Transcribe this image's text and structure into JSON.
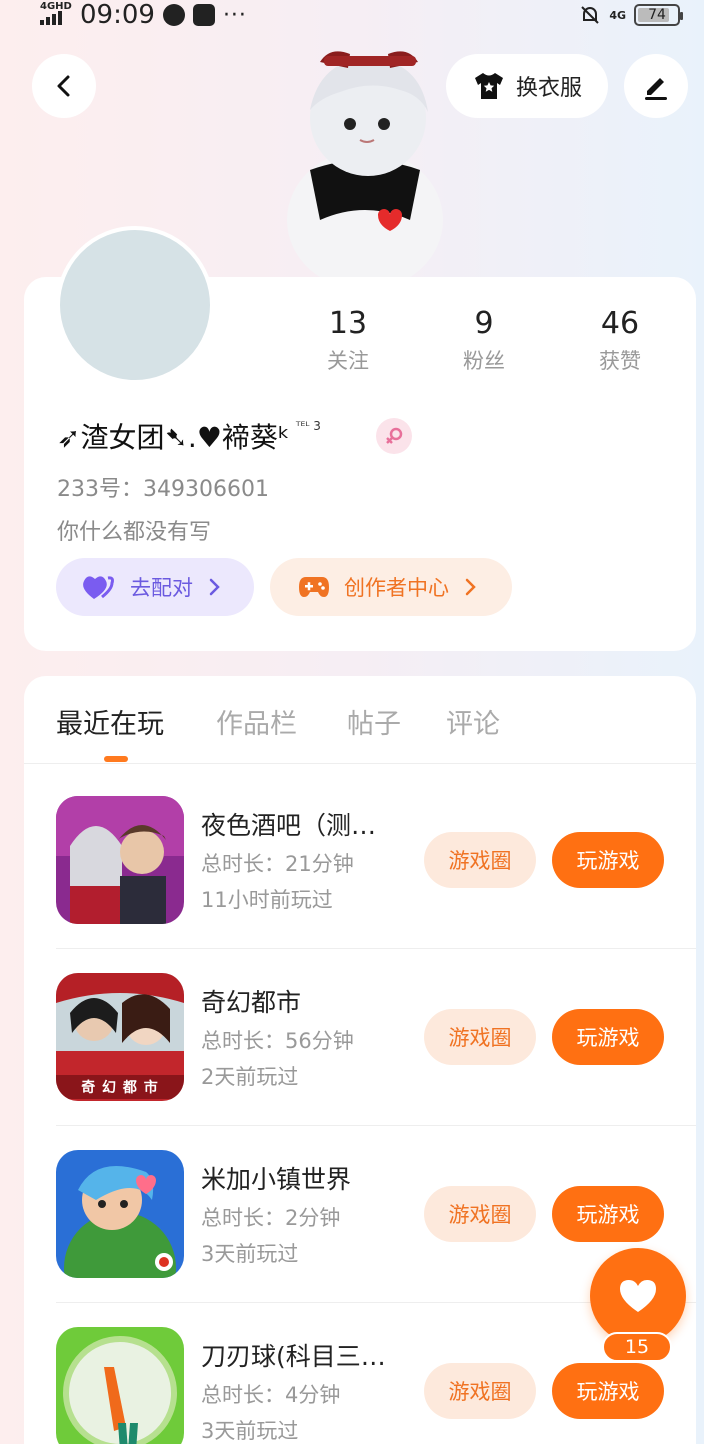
{
  "status_bar": {
    "network": "4GHD",
    "time": "09:09",
    "battery": "74",
    "signal_right": "4G"
  },
  "header": {
    "outfit_label": "换衣服"
  },
  "profile": {
    "stats": [
      {
        "value": "13",
        "label": "关注"
      },
      {
        "value": "9",
        "label": "粉丝"
      },
      {
        "value": "46",
        "label": "获赞"
      }
    ],
    "nickname": "➶渣女团➷.♥褅葵ᵏ",
    "nickname_sup": "ᵀᴱᴸ 3",
    "uid": "233号：349306601",
    "bio": "你什么都没有写",
    "match_label": "去配对",
    "creator_label": "创作者中心"
  },
  "tabs": [
    {
      "label": "最近在玩"
    },
    {
      "label": "作品栏"
    },
    {
      "label": "帖子"
    },
    {
      "label": "评论"
    }
  ],
  "games": [
    {
      "title": "夜色酒吧（测…",
      "duration": "总时长：21分钟",
      "last_played": "11小时前玩过",
      "circle_label": "游戏圈",
      "play_label": "玩游戏"
    },
    {
      "title": "奇幻都市",
      "duration": "总时长：56分钟",
      "last_played": "2天前玩过",
      "circle_label": "游戏圈",
      "play_label": "玩游戏",
      "thumb_text": "奇 幻 都 市"
    },
    {
      "title": "米加小镇世界",
      "duration": "总时长：2分钟",
      "last_played": "3天前玩过",
      "circle_label": "游戏圈",
      "play_label": "玩游戏"
    },
    {
      "title": "刀刃球(科目三…",
      "duration": "总时长：4分钟",
      "last_played": "3天前玩过",
      "circle_label": "游戏圈",
      "play_label": "玩游戏"
    }
  ],
  "fab": {
    "count": "15"
  },
  "colors": {
    "accent": "#ff7012",
    "match": "#6b5ae0"
  }
}
